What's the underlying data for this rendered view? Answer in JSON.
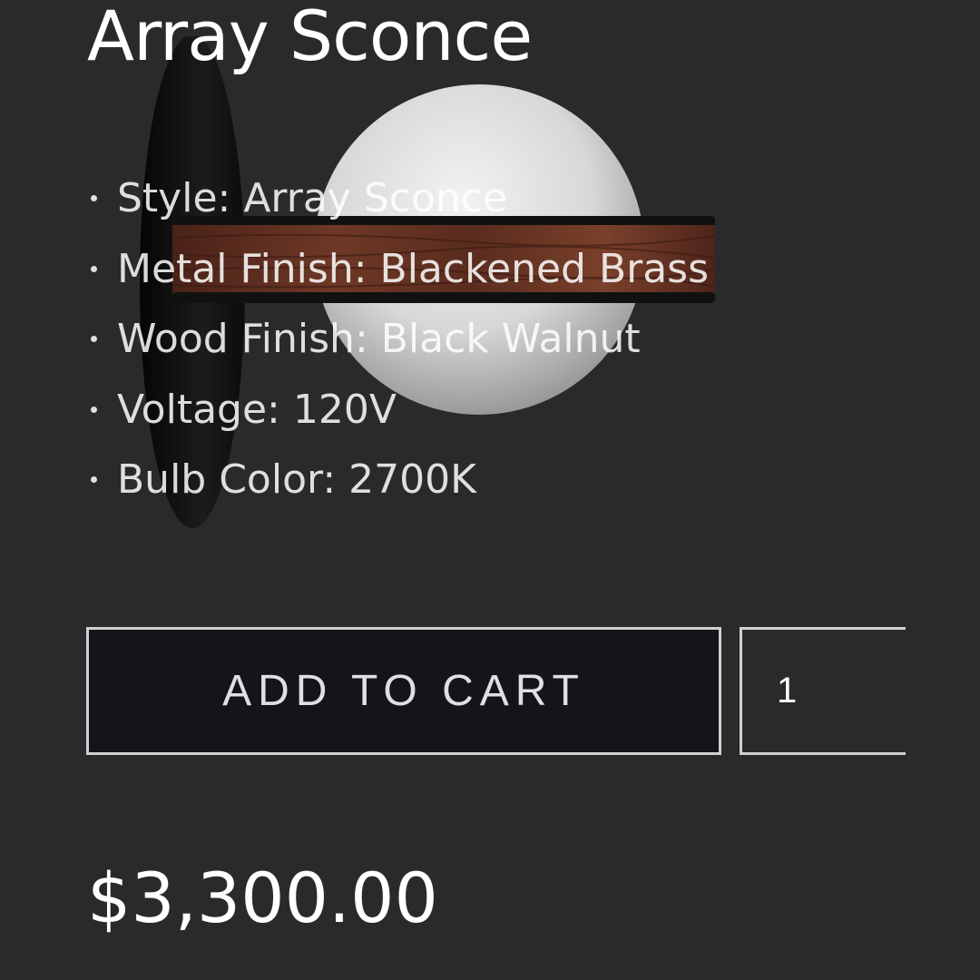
{
  "product": {
    "title": "Array Sconce",
    "image_icon": "sconce-lamp-image",
    "specs": [
      {
        "text": "Style: Array Sconce"
      },
      {
        "text": "Metal Finish: Blackened Brass"
      },
      {
        "text": "Wood Finish: Black Walnut"
      },
      {
        "text": "Voltage: 120V"
      },
      {
        "text": "Bulb Color: 2700K"
      }
    ]
  },
  "cart": {
    "button_label": "ADD TO CART",
    "quantity": "1"
  },
  "price": "$3,300.00",
  "colors": {
    "background": "#2a2a2a",
    "button_background": "#14141a",
    "border": "#d0d0d0",
    "text": "#ffffff"
  }
}
